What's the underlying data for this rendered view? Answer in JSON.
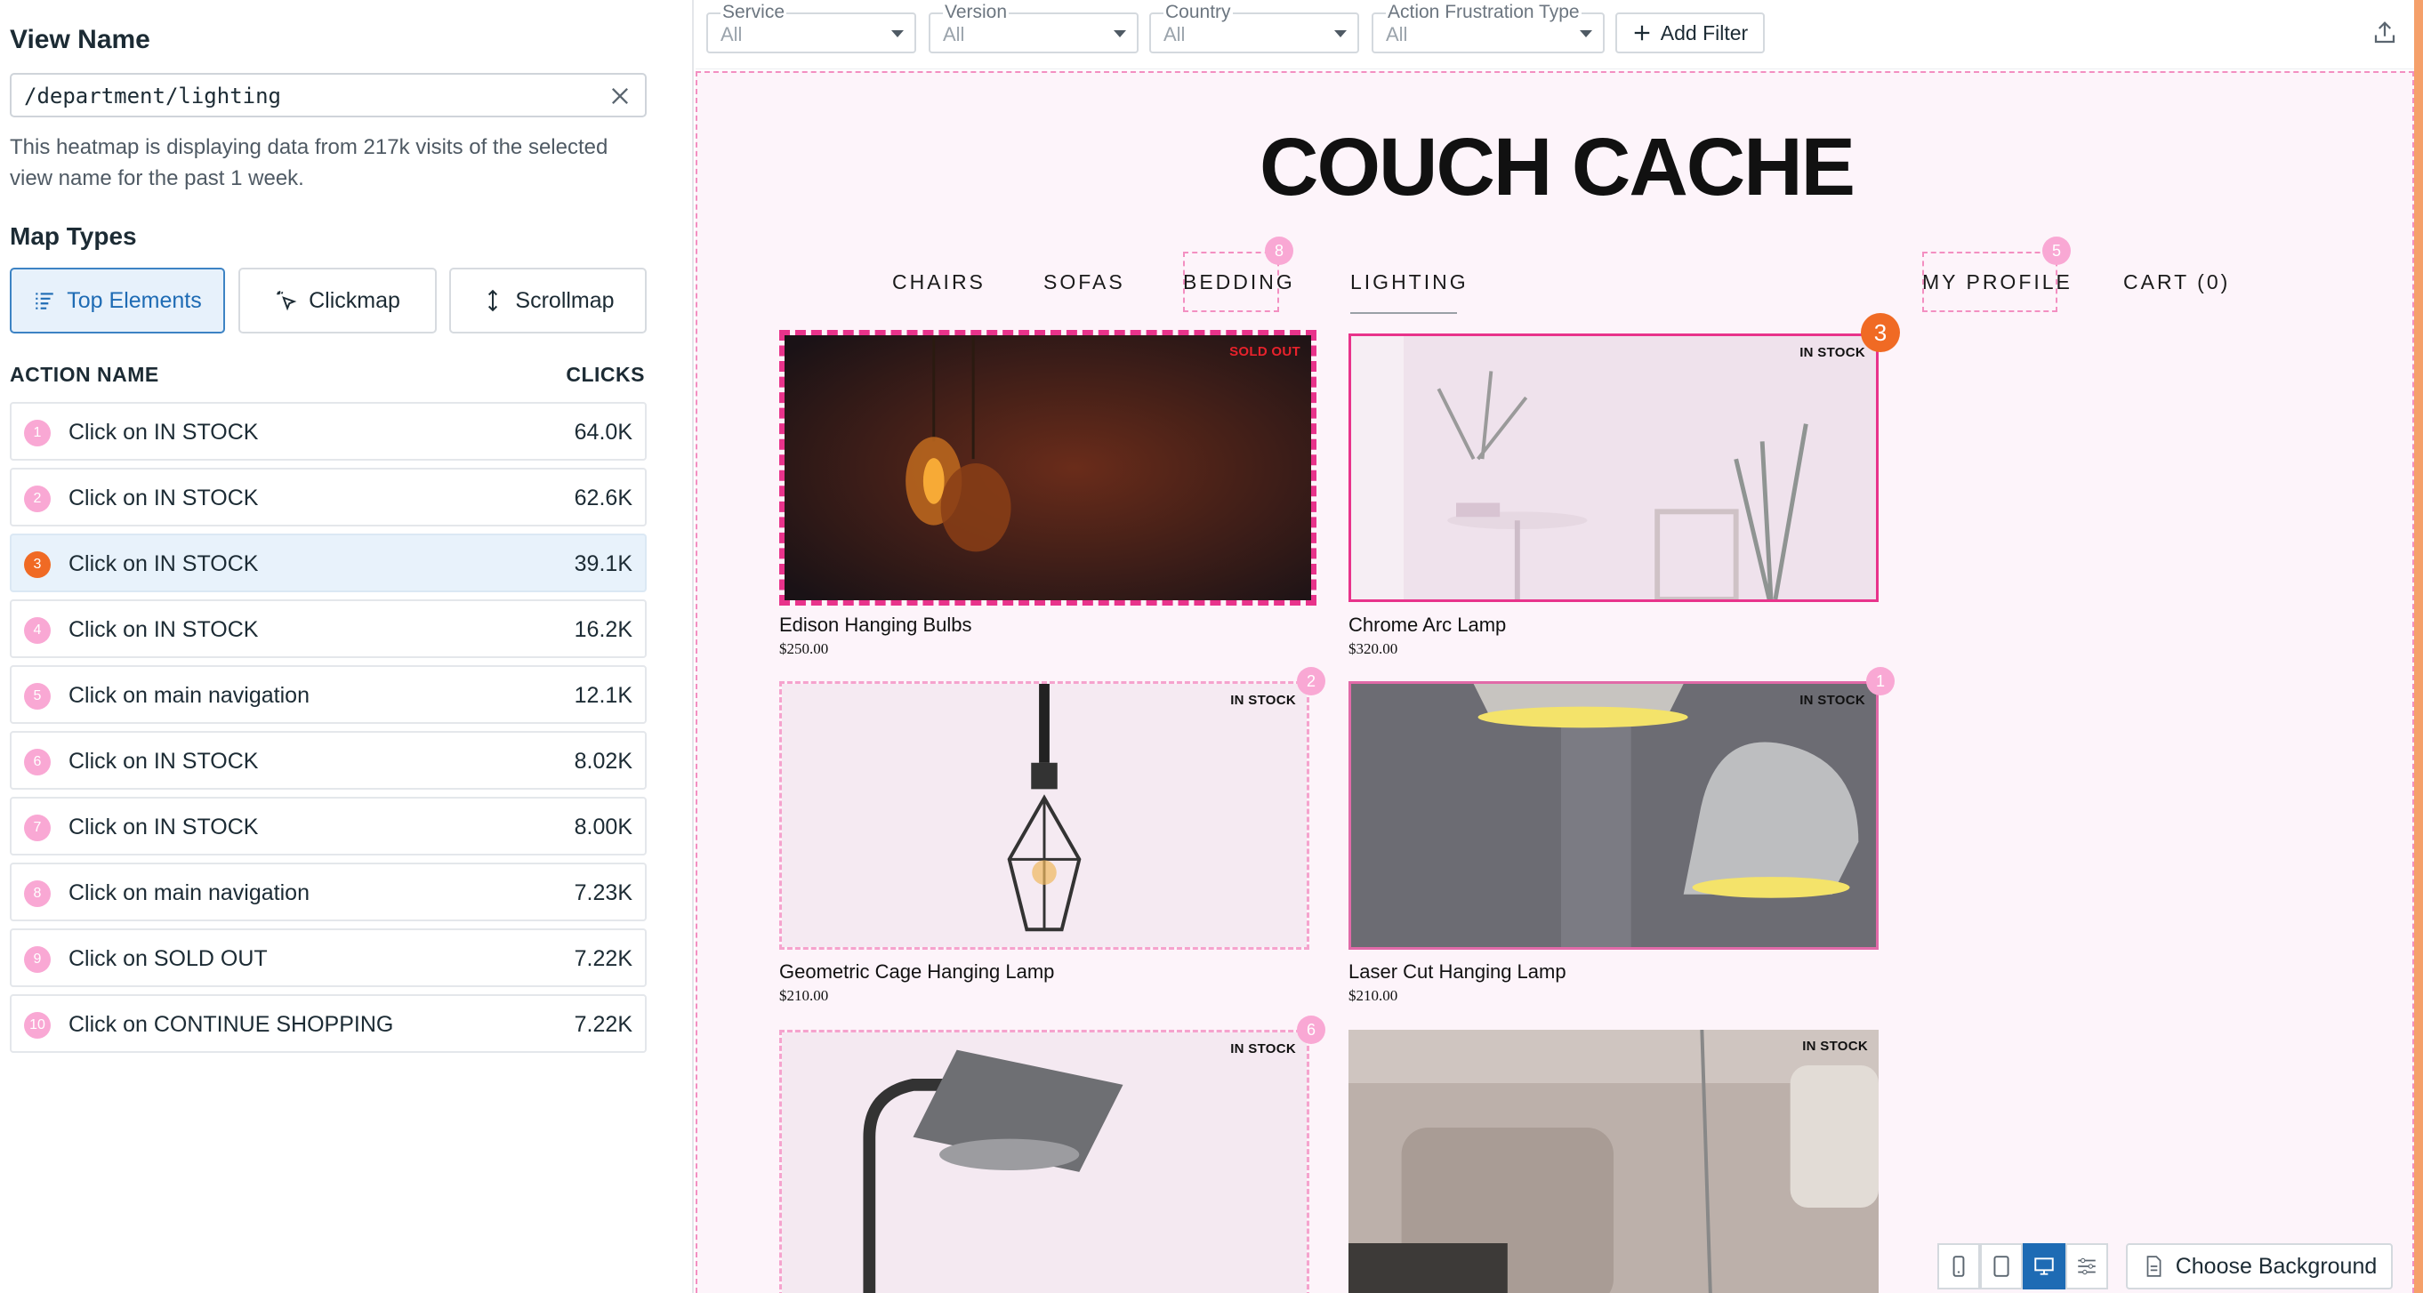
{
  "left": {
    "view_name_title": "View Name",
    "view_name_value": "/department/lighting",
    "description": "This heatmap is displaying data from 217k visits of the selected view name for the past 1 week.",
    "map_types_title": "Map Types",
    "map_types": [
      {
        "label": "Top Elements",
        "icon": "list-icon",
        "active": true
      },
      {
        "label": "Clickmap",
        "icon": "cursor-click-icon",
        "active": false
      },
      {
        "label": "Scrollmap",
        "icon": "vertical-arrows-icon",
        "active": false
      }
    ],
    "columns": {
      "action": "ACTION NAME",
      "clicks": "CLICKS"
    },
    "actions": [
      {
        "rank": "1",
        "name": "Click on IN STOCK",
        "clicks": "64.0K"
      },
      {
        "rank": "2",
        "name": "Click on IN STOCK",
        "clicks": "62.6K"
      },
      {
        "rank": "3",
        "name": "Click on IN STOCK",
        "clicks": "39.1K",
        "selected": true
      },
      {
        "rank": "4",
        "name": "Click on IN STOCK",
        "clicks": "16.2K"
      },
      {
        "rank": "5",
        "name": "Click on main navigation",
        "clicks": "12.1K"
      },
      {
        "rank": "6",
        "name": "Click on IN STOCK",
        "clicks": "8.02K"
      },
      {
        "rank": "7",
        "name": "Click on IN STOCK",
        "clicks": "8.00K"
      },
      {
        "rank": "8",
        "name": "Click on main navigation",
        "clicks": "7.23K"
      },
      {
        "rank": "9",
        "name": "Click on SOLD OUT",
        "clicks": "7.22K"
      },
      {
        "rank": "10",
        "name": "Click on CONTINUE SHOPPING",
        "clicks": "7.22K"
      }
    ]
  },
  "filters": [
    {
      "label": "Service",
      "value": "All"
    },
    {
      "label": "Version",
      "value": "All"
    },
    {
      "label": "Country",
      "value": "All"
    },
    {
      "label": "Action Frustration Type",
      "value": "All"
    }
  ],
  "add_filter_label": "Add Filter",
  "site": {
    "brand": "COUCH CACHE",
    "nav": [
      "CHAIRS",
      "SOFAS",
      "BEDDING",
      "LIGHTING",
      "MY PROFILE",
      "CART (0)"
    ],
    "nav_badges": {
      "bedding": "8",
      "profile": "5"
    },
    "products": [
      {
        "name": "Edison Hanging Bulbs",
        "price": "$250.00",
        "stock": "SOLD OUT"
      },
      {
        "name": "Chrome Arc Lamp",
        "price": "$320.00",
        "stock": "IN STOCK",
        "badge": "3"
      },
      {
        "name": "Geometric Cage Hanging Lamp",
        "price": "$210.00",
        "stock": "IN STOCK",
        "badge": "2"
      },
      {
        "name": "Laser Cut Hanging Lamp",
        "price": "$210.00",
        "stock": "IN STOCK",
        "badge": "1"
      },
      {
        "name": "",
        "price": "",
        "stock": "IN STOCK",
        "badge": "6"
      },
      {
        "name": "",
        "price": "",
        "stock": "IN STOCK"
      }
    ]
  },
  "bottom": {
    "devices": [
      "phone-icon",
      "tablet-icon",
      "desktop-icon",
      "sliders-icon"
    ],
    "active_device": "desktop-icon",
    "choose_background": "Choose Background"
  },
  "colors": {
    "accent": "#1e6bb4",
    "heat_pink": "#e8338b",
    "badge_pink": "#f9a8d4",
    "badge_orange": "#f06a24",
    "sold_out_red": "#e8222c"
  }
}
